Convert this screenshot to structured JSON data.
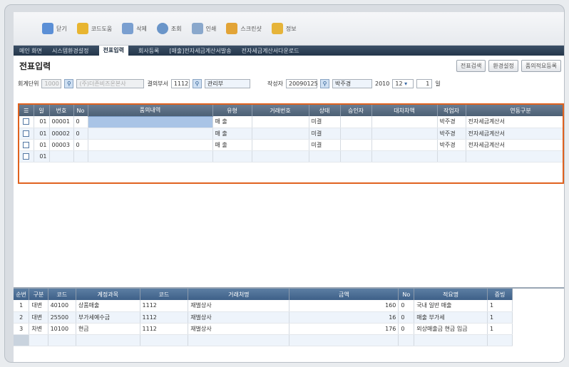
{
  "toolbar": {
    "buttons": [
      {
        "label": "닫기",
        "icon": "close-icon",
        "color": "#5b8fd6"
      },
      {
        "label": "코드도움",
        "icon": "code-help-icon",
        "color": "#e8b531"
      },
      {
        "label": "삭제",
        "icon": "delete-icon",
        "color": "#7a9fd0"
      },
      {
        "label": "조회",
        "icon": "search-icon",
        "color": "#6a95c9"
      },
      {
        "label": "인쇄",
        "icon": "print-icon",
        "color": "#8aa8cc"
      },
      {
        "label": "스크린샷",
        "icon": "screenshot-icon",
        "color": "#e2a437"
      },
      {
        "label": "정보",
        "icon": "info-icon",
        "color": "#e6b43a"
      }
    ]
  },
  "tabs": [
    "메인 화면",
    "시스템환경설정",
    "전표입력",
    "회사등록",
    "[매출]전자세금계산서발송",
    "전자세금계산서다운로드"
  ],
  "active_tab": 2,
  "title": "전표입력",
  "title_buttons": [
    "전표검색",
    "환경설정",
    "품의적요등록"
  ],
  "filter": {
    "company_label": "회계단위",
    "company_code": "1000",
    "company_name": "(주)더존비즈온본사",
    "dept_label": "결의부서",
    "dept_code": "1112",
    "dept_name": "관리부",
    "writer_label": "작성자",
    "writer_code": "20090125",
    "writer_name": "박주경",
    "year": "2010",
    "month": "12",
    "day": "1",
    "day_suffix": "일"
  },
  "upper_grid": {
    "headers": [
      "일",
      "번호",
      "No",
      "품의내역",
      "유형",
      "거래번호",
      "상태",
      "승인자",
      "대차차액",
      "작업자",
      "연동구분"
    ],
    "rows": [
      {
        "day": "01",
        "no": "00001",
        "n": "0",
        "desc": "",
        "type": "매 출",
        "txn": "",
        "status": "미결",
        "approver": "",
        "diff": "",
        "worker": "박주경",
        "link": "전자세금계산서"
      },
      {
        "day": "01",
        "no": "00002",
        "n": "0",
        "desc": "",
        "type": "매 출",
        "txn": "",
        "status": "미결",
        "approver": "",
        "diff": "",
        "worker": "박주경",
        "link": "전자세금계산서"
      },
      {
        "day": "01",
        "no": "00003",
        "n": "0",
        "desc": "",
        "type": "매 출",
        "txn": "",
        "status": "미결",
        "approver": "",
        "diff": "",
        "worker": "박주경",
        "link": "전자세금계산서"
      },
      {
        "day": "01",
        "no": "",
        "n": "",
        "desc": "",
        "type": "",
        "txn": "",
        "status": "",
        "approver": "",
        "diff": "",
        "worker": "",
        "link": ""
      }
    ]
  },
  "lower_grid": {
    "headers": [
      "순번",
      "구분",
      "코드",
      "계정과목",
      "코드",
      "거래처명",
      "금액",
      "No",
      "적요명",
      "증빙"
    ],
    "rows": [
      {
        "seq": "1",
        "kind": "대변",
        "code": "40100",
        "account": "상품매출",
        "pcode": "1112",
        "partner": "재벌상사",
        "amount": "160",
        "no": "0",
        "memo": "국내 일반 매출",
        "proof": "1"
      },
      {
        "seq": "2",
        "kind": "대변",
        "code": "25500",
        "account": "부가세예수금",
        "pcode": "1112",
        "partner": "재벌상사",
        "amount": "16",
        "no": "0",
        "memo": "매출 부가세",
        "proof": "1"
      },
      {
        "seq": "3",
        "kind": "차변",
        "code": "10100",
        "account": "현금",
        "pcode": "1112",
        "partner": "재벌상사",
        "amount": "176",
        "no": "0",
        "memo": "외상매출금 현금 입금",
        "proof": "1"
      }
    ]
  }
}
